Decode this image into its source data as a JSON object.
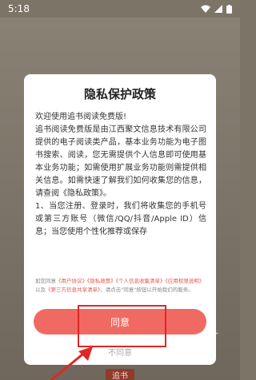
{
  "status_bar": {
    "time": "5:18",
    "icons": [
      "wifi-icon",
      "signal-icon",
      "battery-icon"
    ]
  },
  "background": {
    "bottom_tab_label": "追书"
  },
  "dialog": {
    "title": "隐私保护政策",
    "paragraphs": [
      "欢迎使用追书阅读免费版!",
      "追书阅读免费版是由江西聚文信息技术有限公司提供的电子阅读类产品，基本业务功能为电子图书搜索、阅读，您无需提供个人信息即可使用基本业务功能；如需使用扩展业务功能则需提供相关信息。如需快速了解我们如何收集您的信息，请查阅《隐私政策》。",
      "1、当您注册、登录时，我们将收集您的手机号或第三方账号（微信/QQ/抖音/Apple ID）信息；当您使用个性化推荐或保存"
    ],
    "agreement": {
      "prefix": "如您同意",
      "link1": "《用户协议》",
      "link2": "《隐私政策》",
      "link3": "《个人信息收集清单》",
      "link4": "《应用权限说明》",
      "and": "以及",
      "link5": "《第三方信息共享清单》",
      "suffix": "，请点击\"同意\"按钮以开始我们的服务。"
    },
    "agree_label": "同意",
    "disagree_label": "不同意"
  },
  "watermark": "上 果",
  "colors": {
    "accent": "#f06a63",
    "link": "#e0574d",
    "annotation": "#e02626"
  }
}
